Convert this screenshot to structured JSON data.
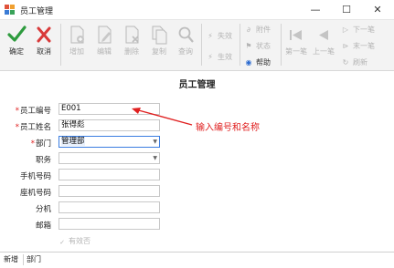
{
  "window": {
    "title": "员工管理",
    "minimize": "—",
    "maximize": "☐",
    "close": "✕"
  },
  "toolbar": {
    "confirm": "确定",
    "cancel": "取消",
    "add": "增加",
    "edit": "编辑",
    "delete": "删除",
    "copy": "复制",
    "query": "查询",
    "invalidate": "失效",
    "activate": "生效",
    "attachment": "附件",
    "status": "状态",
    "help": "帮助",
    "first": "第一笔",
    "previous": "上一笔",
    "next": "下一笔",
    "last": "末一笔",
    "refresh": "刷新"
  },
  "form": {
    "heading": "员工管理",
    "fields": [
      {
        "label": "员工编号",
        "value": "E001",
        "required": true
      },
      {
        "label": "员工姓名",
        "value": "张得彪",
        "required": true
      },
      {
        "label": "部门",
        "value": "管理部",
        "required": true
      },
      {
        "label": "职务",
        "value": "",
        "required": false
      },
      {
        "label": "手机号码",
        "value": "",
        "required": false
      },
      {
        "label": "座机号码",
        "value": "",
        "required": false
      },
      {
        "label": "分机",
        "value": "",
        "required": false
      },
      {
        "label": "邮箱",
        "value": "",
        "required": false
      }
    ],
    "active_checkbox": {
      "label": "有效否",
      "checked": true
    }
  },
  "annotation": "输入编号和名称",
  "tabs": [
    "新增",
    "部门"
  ],
  "colors": {
    "accent_red": "#e02020",
    "confirm_green": "#2e9b3e",
    "cancel_red": "#d93a3a"
  }
}
